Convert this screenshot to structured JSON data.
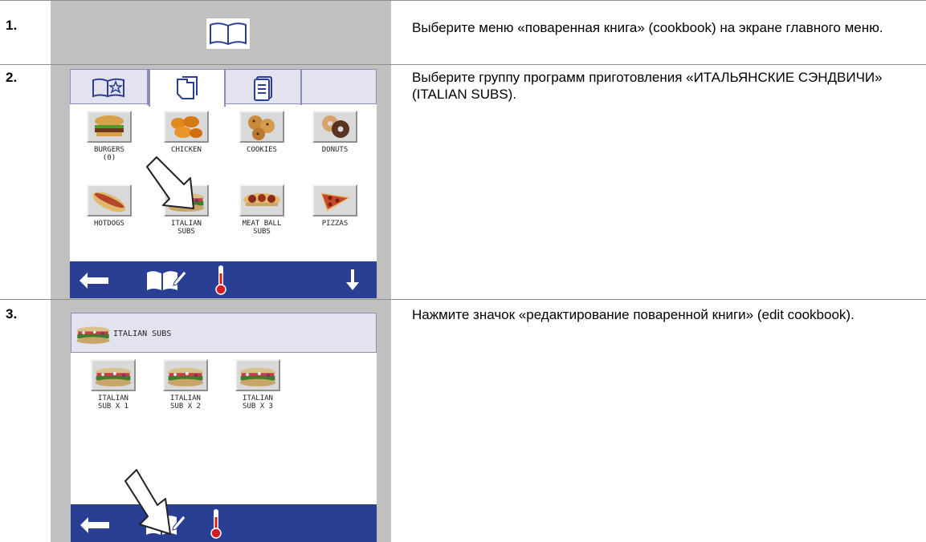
{
  "steps": [
    {
      "number": "1.",
      "description": "Выберите меню «поваренная книга» (cookbook) на экране главного меню.",
      "icon": "book-icon"
    },
    {
      "number": "2.",
      "description": "Выберите группу программ приготовления «ИТАЛЬЯНСКИЕ СЭНДВИЧИ» (ITALIAN SUBS).",
      "tabs": [
        "book-star-icon",
        "documents-icon",
        "document-list-icon",
        ""
      ],
      "items": [
        {
          "caption": "BURGERS\n(0)",
          "icon": "burger-icon"
        },
        {
          "caption": "CHICKEN",
          "icon": "chicken-icon"
        },
        {
          "caption": "COOKIES",
          "icon": "cookies-icon"
        },
        {
          "caption": "DONUTS",
          "icon": "donuts-icon"
        },
        {
          "caption": "HOTDOGS",
          "icon": "hotdog-icon"
        },
        {
          "caption": "ITALIAN\nSUBS",
          "icon": "italian-sub-icon"
        },
        {
          "caption": "MEAT BALL\nSUBS",
          "icon": "meatball-sub-icon"
        },
        {
          "caption": "PIZZAS",
          "icon": "pizza-icon"
        }
      ],
      "bottom_icons": [
        "back-arrow-icon",
        "edit-cookbook-icon",
        "thermometer-icon",
        "down-arrow-icon"
      ]
    },
    {
      "number": "3.",
      "description": "Нажмите значок «редактирование поваренной книги» (edit cookbook).",
      "header_title": "ITALIAN SUBS",
      "items": [
        {
          "caption": "ITALIAN\nSUB X 1",
          "icon": "italian-sub-icon"
        },
        {
          "caption": "ITALIAN\nSUB X 2",
          "icon": "italian-sub-icon"
        },
        {
          "caption": "ITALIAN\nSUB X 3",
          "icon": "italian-sub-icon"
        }
      ],
      "bottom_icons": [
        "back-arrow-icon",
        "edit-cookbook-icon",
        "thermometer-icon"
      ]
    }
  ],
  "colors": {
    "panel_gray": "#c0c0c0",
    "bar_blue": "#2a3f93",
    "tab_bg": "#e3e3ef"
  }
}
